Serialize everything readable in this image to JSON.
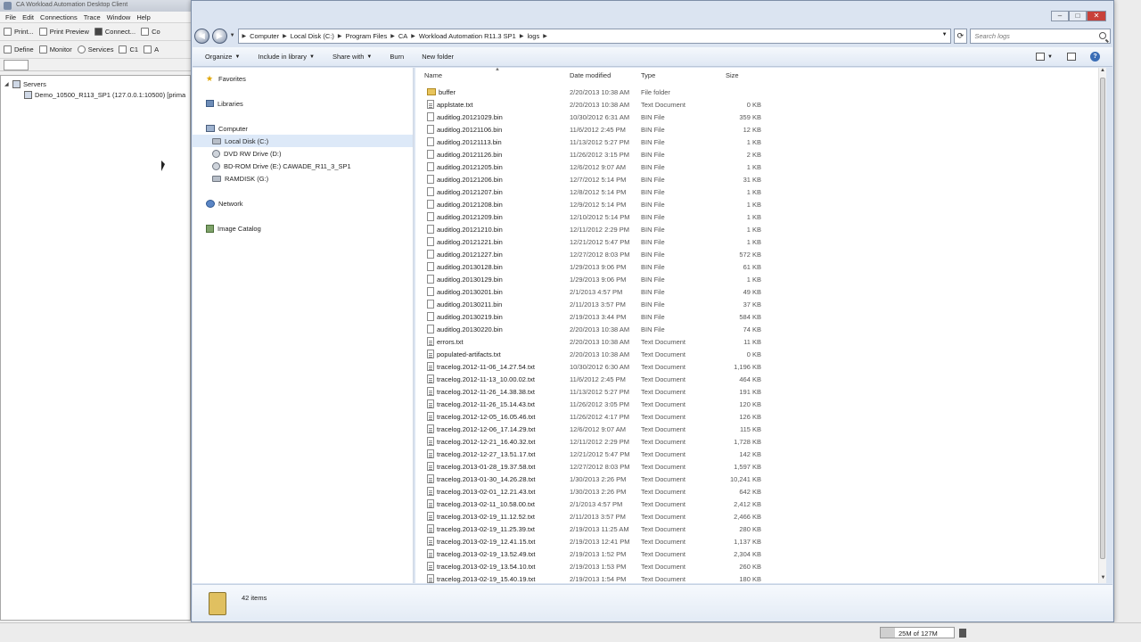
{
  "bg_app": {
    "title": "CA Workload Automation Desktop Client",
    "menu": [
      "File",
      "Edit",
      "Connections",
      "Trace",
      "Window",
      "Help"
    ],
    "toolbar1": [
      "Print...",
      "Print Preview",
      "Connect...",
      "Co"
    ],
    "toolbar2": [
      "Define",
      "Monitor",
      "Services",
      "C1",
      "A"
    ],
    "tree": {
      "root": "Servers",
      "child": "Demo_10500_R113_SP1 (127.0.0.1:10500) [prima"
    },
    "memory": "25M of 127M",
    "memory_fraction": 0.2
  },
  "explorer": {
    "address": [
      "Computer",
      "Local Disk (C:)",
      "Program Files",
      "CA",
      "Workload Automation R11.3 SP1",
      "logs"
    ],
    "search_placeholder": "Search logs",
    "commands": [
      "Organize",
      "Include in library",
      "Share with",
      "Burn",
      "New folder"
    ],
    "nav": {
      "favorites": "Favorites",
      "libraries": "Libraries",
      "computer": "Computer",
      "drives": [
        "Local Disk (C:)",
        "DVD RW Drive (D:)",
        "BD-ROM Drive (E:) CAWADE_R11_3_SP1",
        "RAMDISK (G:)"
      ],
      "network": "Network",
      "image_catalog": "Image Catalog"
    },
    "columns": {
      "name": "Name",
      "date": "Date modified",
      "type": "Type",
      "size": "Size"
    },
    "files": [
      {
        "name": "buffer",
        "date": "2/20/2013 10:38 AM",
        "type": "File folder",
        "size": "",
        "icon": "folder"
      },
      {
        "name": "applstate.txt",
        "date": "2/20/2013 10:38 AM",
        "type": "Text Document",
        "size": "0 KB",
        "icon": "txt"
      },
      {
        "name": "auditlog.20121029.bin",
        "date": "10/30/2012 6:31 AM",
        "type": "BIN File",
        "size": "359 KB",
        "icon": "bin"
      },
      {
        "name": "auditlog.20121106.bin",
        "date": "11/6/2012 2:45 PM",
        "type": "BIN File",
        "size": "12 KB",
        "icon": "bin"
      },
      {
        "name": "auditlog.20121113.bin",
        "date": "11/13/2012 5:27 PM",
        "type": "BIN File",
        "size": "1 KB",
        "icon": "bin"
      },
      {
        "name": "auditlog.20121126.bin",
        "date": "11/26/2012 3:15 PM",
        "type": "BIN File",
        "size": "2 KB",
        "icon": "bin"
      },
      {
        "name": "auditlog.20121205.bin",
        "date": "12/6/2012 9:07 AM",
        "type": "BIN File",
        "size": "1 KB",
        "icon": "bin"
      },
      {
        "name": "auditlog.20121206.bin",
        "date": "12/7/2012 5:14 PM",
        "type": "BIN File",
        "size": "31 KB",
        "icon": "bin"
      },
      {
        "name": "auditlog.20121207.bin",
        "date": "12/8/2012 5:14 PM",
        "type": "BIN File",
        "size": "1 KB",
        "icon": "bin"
      },
      {
        "name": "auditlog.20121208.bin",
        "date": "12/9/2012 5:14 PM",
        "type": "BIN File",
        "size": "1 KB",
        "icon": "bin"
      },
      {
        "name": "auditlog.20121209.bin",
        "date": "12/10/2012 5:14 PM",
        "type": "BIN File",
        "size": "1 KB",
        "icon": "bin"
      },
      {
        "name": "auditlog.20121210.bin",
        "date": "12/11/2012 2:29 PM",
        "type": "BIN File",
        "size": "1 KB",
        "icon": "bin"
      },
      {
        "name": "auditlog.20121221.bin",
        "date": "12/21/2012 5:47 PM",
        "type": "BIN File",
        "size": "1 KB",
        "icon": "bin"
      },
      {
        "name": "auditlog.20121227.bin",
        "date": "12/27/2012 8:03 PM",
        "type": "BIN File",
        "size": "572 KB",
        "icon": "bin"
      },
      {
        "name": "auditlog.20130128.bin",
        "date": "1/29/2013 9:06 PM",
        "type": "BIN File",
        "size": "61 KB",
        "icon": "bin"
      },
      {
        "name": "auditlog.20130129.bin",
        "date": "1/29/2013 9:06 PM",
        "type": "BIN File",
        "size": "1 KB",
        "icon": "bin"
      },
      {
        "name": "auditlog.20130201.bin",
        "date": "2/1/2013 4:57 PM",
        "type": "BIN File",
        "size": "49 KB",
        "icon": "bin"
      },
      {
        "name": "auditlog.20130211.bin",
        "date": "2/11/2013 3:57 PM",
        "type": "BIN File",
        "size": "37 KB",
        "icon": "bin"
      },
      {
        "name": "auditlog.20130219.bin",
        "date": "2/19/2013 3:44 PM",
        "type": "BIN File",
        "size": "584 KB",
        "icon": "bin"
      },
      {
        "name": "auditlog.20130220.bin",
        "date": "2/20/2013 10:38 AM",
        "type": "BIN File",
        "size": "74 KB",
        "icon": "bin"
      },
      {
        "name": "errors.txt",
        "date": "2/20/2013 10:38 AM",
        "type": "Text Document",
        "size": "11 KB",
        "icon": "txt"
      },
      {
        "name": "populated-artifacts.txt",
        "date": "2/20/2013 10:38 AM",
        "type": "Text Document",
        "size": "0 KB",
        "icon": "txt"
      },
      {
        "name": "tracelog.2012-11-06_14.27.54.txt",
        "date": "10/30/2012 6:30 AM",
        "type": "Text Document",
        "size": "1,196 KB",
        "icon": "txt"
      },
      {
        "name": "tracelog.2012-11-13_10.00.02.txt",
        "date": "11/6/2012 2:45 PM",
        "type": "Text Document",
        "size": "464 KB",
        "icon": "txt"
      },
      {
        "name": "tracelog.2012-11-26_14.38.38.txt",
        "date": "11/13/2012 5:27 PM",
        "type": "Text Document",
        "size": "191 KB",
        "icon": "txt"
      },
      {
        "name": "tracelog.2012-11-26_15.14.43.txt",
        "date": "11/26/2012 3:05 PM",
        "type": "Text Document",
        "size": "120 KB",
        "icon": "txt"
      },
      {
        "name": "tracelog.2012-12-05_16.05.46.txt",
        "date": "11/26/2012 4:17 PM",
        "type": "Text Document",
        "size": "126 KB",
        "icon": "txt"
      },
      {
        "name": "tracelog.2012-12-06_17.14.29.txt",
        "date": "12/6/2012 9:07 AM",
        "type": "Text Document",
        "size": "115 KB",
        "icon": "txt"
      },
      {
        "name": "tracelog.2012-12-21_16.40.32.txt",
        "date": "12/11/2012 2:29 PM",
        "type": "Text Document",
        "size": "1,728 KB",
        "icon": "txt"
      },
      {
        "name": "tracelog.2012-12-27_13.51.17.txt",
        "date": "12/21/2012 5:47 PM",
        "type": "Text Document",
        "size": "142 KB",
        "icon": "txt"
      },
      {
        "name": "tracelog.2013-01-28_19.37.58.txt",
        "date": "12/27/2012 8:03 PM",
        "type": "Text Document",
        "size": "1,597 KB",
        "icon": "txt"
      },
      {
        "name": "tracelog.2013-01-30_14.26.28.txt",
        "date": "1/30/2013 2:26 PM",
        "type": "Text Document",
        "size": "10,241 KB",
        "icon": "txt"
      },
      {
        "name": "tracelog.2013-02-01_12.21.43.txt",
        "date": "1/30/2013 2:26 PM",
        "type": "Text Document",
        "size": "642 KB",
        "icon": "txt"
      },
      {
        "name": "tracelog.2013-02-11_10.58.00.txt",
        "date": "2/1/2013 4:57 PM",
        "type": "Text Document",
        "size": "2,412 KB",
        "icon": "txt"
      },
      {
        "name": "tracelog.2013-02-19_11.12.52.txt",
        "date": "2/11/2013 3:57 PM",
        "type": "Text Document",
        "size": "2,466 KB",
        "icon": "txt"
      },
      {
        "name": "tracelog.2013-02-19_11.25.39.txt",
        "date": "2/19/2013 11:25 AM",
        "type": "Text Document",
        "size": "280 KB",
        "icon": "txt"
      },
      {
        "name": "tracelog.2013-02-19_12.41.15.txt",
        "date": "2/19/2013 12:41 PM",
        "type": "Text Document",
        "size": "1,137 KB",
        "icon": "txt"
      },
      {
        "name": "tracelog.2013-02-19_13.52.49.txt",
        "date": "2/19/2013 1:52 PM",
        "type": "Text Document",
        "size": "2,304 KB",
        "icon": "txt"
      },
      {
        "name": "tracelog.2013-02-19_13.54.10.txt",
        "date": "2/19/2013 1:53 PM",
        "type": "Text Document",
        "size": "260 KB",
        "icon": "txt"
      },
      {
        "name": "tracelog.2013-02-19_15.40.19.txt",
        "date": "2/19/2013 1:54 PM",
        "type": "Text Document",
        "size": "180 KB",
        "icon": "txt"
      }
    ],
    "item_count": "42 items"
  }
}
